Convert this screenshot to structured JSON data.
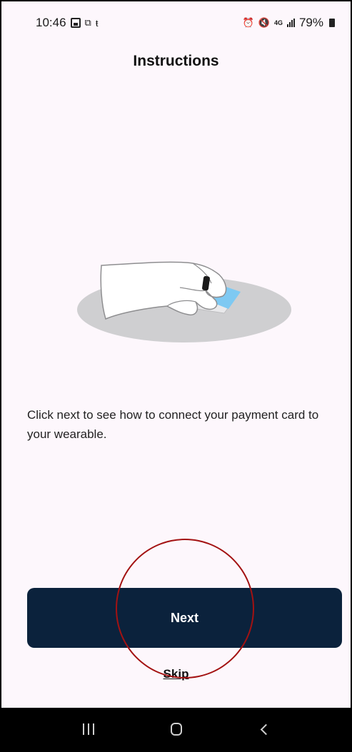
{
  "status_bar": {
    "time": "10:46",
    "network": "4G",
    "battery": "79%"
  },
  "header": {
    "title": "Instructions"
  },
  "main": {
    "illustration": "hand-with-ring-tapping-card",
    "description": "Click next to see how to connect your payment card to your wearable."
  },
  "actions": {
    "next_label": "Next",
    "skip_label": "Skip"
  },
  "colors": {
    "primary_button": "#0b223c",
    "highlight_ring": "#a31212",
    "background": "#fdf7fc"
  },
  "nav": {
    "icons": [
      "recent-apps-icon",
      "home-icon",
      "back-icon"
    ]
  }
}
